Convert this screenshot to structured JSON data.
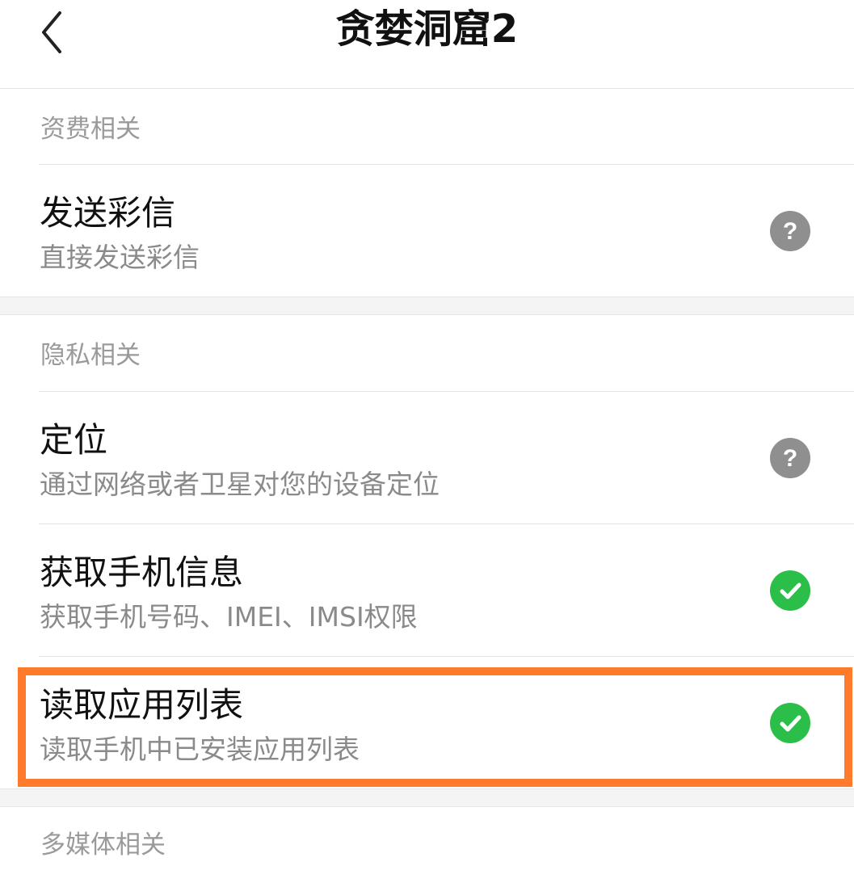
{
  "header": {
    "title": "贪婪洞窟2",
    "back_icon": "back-chevron-icon"
  },
  "sections": [
    {
      "label": "资费相关",
      "items": [
        {
          "title": "发送彩信",
          "description": "直接发送彩信",
          "status_icon": "help-question-icon",
          "status": "unknown"
        }
      ]
    },
    {
      "label": "隐私相关",
      "items": [
        {
          "title": "定位",
          "description": "通过网络或者卫星对您的设备定位",
          "status_icon": "help-question-icon",
          "status": "unknown"
        },
        {
          "title": "获取手机信息",
          "description": "获取手机号码、IMEI、IMSI权限",
          "status_icon": "checkmark-icon",
          "status": "granted"
        },
        {
          "title": "读取应用列表",
          "description": "读取手机中已安装应用列表",
          "status_icon": "checkmark-icon",
          "status": "granted",
          "highlighted": true
        }
      ]
    },
    {
      "label": "多媒体相关",
      "items": []
    }
  ],
  "colors": {
    "granted": "#2bbf4a",
    "unknown": "#8f8f8f",
    "highlight": "#ff7a2a",
    "section_label": "#9a9a9a",
    "description": "#8a8a8a"
  }
}
